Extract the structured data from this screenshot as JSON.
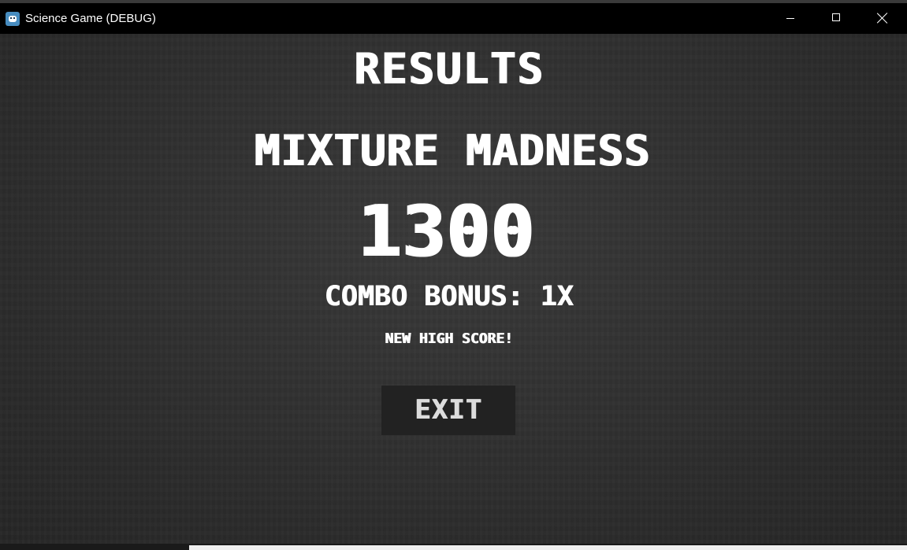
{
  "window": {
    "title": "Science Game (DEBUG)",
    "icon": "godot-engine-icon"
  },
  "results": {
    "heading": "RESULTS",
    "level_name": "MIXTURE MADNESS",
    "score": "1300",
    "combo_bonus": "COMBO BONUS: 1X",
    "high_score_message": "NEW HIGH SCORE!",
    "exit_label": "EXIT"
  },
  "colors": {
    "titlebar": "#000000",
    "background": "#2f2f2f",
    "text": "#ffffff",
    "button": "#222222",
    "button_text": "#dcdcdc"
  }
}
